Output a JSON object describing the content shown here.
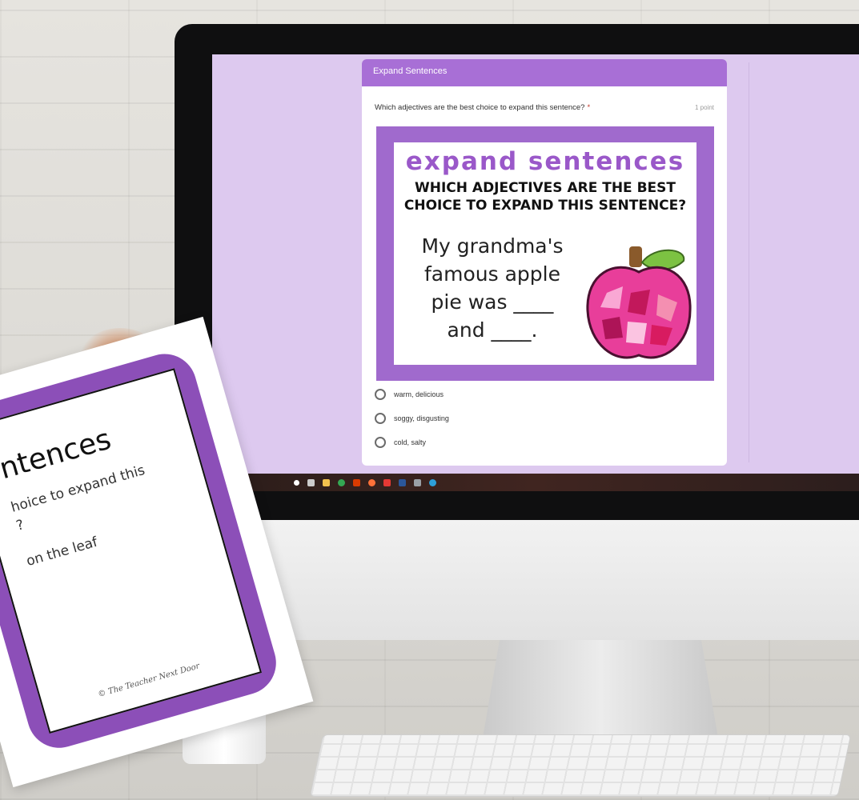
{
  "form": {
    "header_title": "Expand Sentences",
    "question": "Which adjectives are the best choice to expand this sentence?",
    "required_marker": "*",
    "points": "1 point",
    "image": {
      "title": "expand sentences",
      "question_line1": "WHICH ADJECTIVES ARE THE BEST",
      "question_line2": "CHOICE TO EXPAND THIS SENTENCE?",
      "sentence_line1": "My grandma's",
      "sentence_line2": "famous apple",
      "sentence_line3": "pie was ____",
      "sentence_line4": "and ____."
    },
    "options": [
      {
        "label": "warm, delicious"
      },
      {
        "label": "soggy, disgusting"
      },
      {
        "label": "cold, salty"
      }
    ]
  },
  "card": {
    "title": "ntences",
    "line1": "hoice to expand this",
    "line2": "?",
    "line3": "on the leaf",
    "credit": "© The Teacher Next Door"
  },
  "taskbar": {
    "icons": [
      {
        "name": "search-icon",
        "color": "#ffffff"
      },
      {
        "name": "task-view-icon",
        "color": "#cccccc"
      },
      {
        "name": "file-explorer-icon",
        "color": "#f2c14e"
      },
      {
        "name": "chrome-icon",
        "color": "#34a853"
      },
      {
        "name": "office-icon",
        "color": "#d83b01"
      },
      {
        "name": "firefox-icon",
        "color": "#ff7139"
      },
      {
        "name": "acrobat-icon",
        "color": "#e53935"
      },
      {
        "name": "word-icon",
        "color": "#2b579a"
      },
      {
        "name": "app-icon",
        "color": "#9aa0a6"
      },
      {
        "name": "edge-icon",
        "color": "#2d9fd9"
      }
    ]
  },
  "colors": {
    "screen_background": "#ddc9ef",
    "form_header": "#a86fd6",
    "image_frame": "#a06acd",
    "image_title": "#9a58c9",
    "card_frame": "#8c4fb8"
  }
}
